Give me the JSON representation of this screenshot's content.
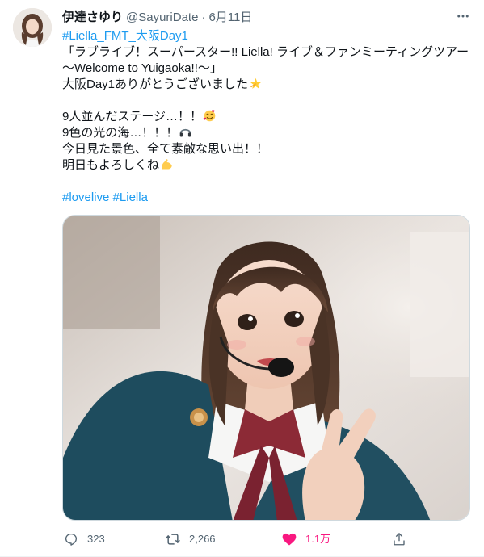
{
  "tweet": {
    "author": {
      "display_name": "伊達さゆり",
      "handle": "@SayuriDate",
      "separator": "·",
      "date": "6月11日"
    },
    "text": {
      "hashtag_fmt": "#Liella_FMT_大阪Day1",
      "line_event_title": "「ラブライブ！スーパースター!! Liella! ライブ＆ファンミーティングツアー",
      "line_event_subtitle": "～Welcome to Yuigaoka!!～」",
      "line_thanks": "大阪Day1ありがとうございました",
      "line_stage": "9人並んだステージ…！！",
      "line_lights": "9色の光の海…！！！",
      "line_memories": "今日見た景色、全て素敵な思い出！！",
      "line_tomorrow": "明日もよろしくね",
      "hashtag_lovelive": "#lovelive",
      "hashtag_liella": "#Liella"
    },
    "icons": {
      "more": "more-dots-icon",
      "sparkle": "dizzy-star-emoji",
      "smile_hearts": "smiling-face-with-hearts-emoji",
      "headphone": "headphone-emoji",
      "muscle": "flexed-biceps-emoji"
    },
    "stats": {
      "replies": "323",
      "retweets": "2,266",
      "likes": "1.1万"
    },
    "colors": {
      "link": "#1d9bf0",
      "muted": "#536471",
      "like": "#f91880",
      "text": "#0f1419"
    }
  }
}
